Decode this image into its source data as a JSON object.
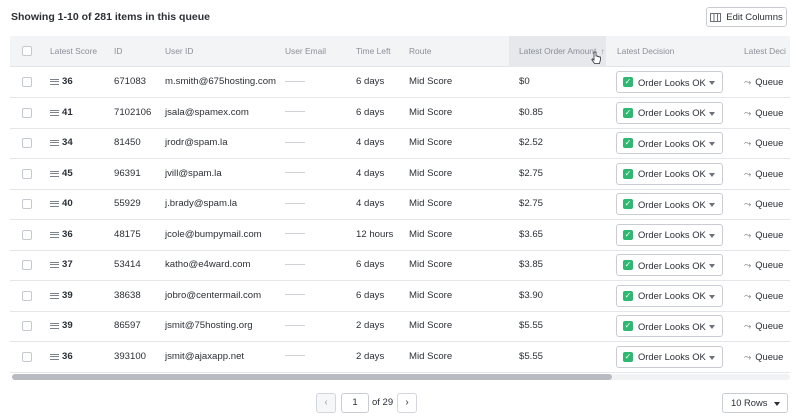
{
  "header": {
    "summary": "Showing 1-10 of 281 items in this queue",
    "edit_columns_label": "Edit Columns"
  },
  "columns": {
    "score": "Latest Score",
    "id": "ID",
    "user_id": "User ID",
    "user_email": "User Email",
    "time_left": "Time Left",
    "route": "Route",
    "amount": "Latest Order Amount",
    "decision": "Latest Decision",
    "decision2": "Latest Deci"
  },
  "sort": {
    "column": "Latest Order Amount",
    "direction": "ascending"
  },
  "rows": [
    {
      "score": "36",
      "id": "671083",
      "user_id": "m.smith@675hosting.com",
      "time_left": "6 days",
      "route": "Mid Score",
      "amount": "$0",
      "decision": "Order Looks OK",
      "queue": "Queue"
    },
    {
      "score": "41",
      "id": "7102106",
      "user_id": "jsala@spamex.com",
      "time_left": "6 days",
      "route": "Mid Score",
      "amount": "$0.85",
      "decision": "Order Looks OK",
      "queue": "Queue"
    },
    {
      "score": "34",
      "id": "81450",
      "user_id": "jrodr@spam.la",
      "time_left": "4 days",
      "route": "Mid Score",
      "amount": "$2.52",
      "decision": "Order Looks OK",
      "queue": "Queue"
    },
    {
      "score": "45",
      "id": "96391",
      "user_id": "jvill@spam.la",
      "time_left": "4 days",
      "route": "Mid Score",
      "amount": "$2.75",
      "decision": "Order Looks OK",
      "queue": "Queue"
    },
    {
      "score": "40",
      "id": "55929",
      "user_id": "j.brady@spam.la",
      "time_left": "4 days",
      "route": "Mid Score",
      "amount": "$2.75",
      "decision": "Order Looks OK",
      "queue": "Queue"
    },
    {
      "score": "36",
      "id": "48175",
      "user_id": "jcole@bumpymail.com",
      "time_left": "12 hours",
      "route": "Mid Score",
      "amount": "$3.65",
      "decision": "Order Looks OK",
      "queue": "Queue"
    },
    {
      "score": "37",
      "id": "53414",
      "user_id": "katho@e4ward.com",
      "time_left": "6 days",
      "route": "Mid Score",
      "amount": "$3.85",
      "decision": "Order Looks OK",
      "queue": "Queue"
    },
    {
      "score": "39",
      "id": "38638",
      "user_id": "jobro@centermail.com",
      "time_left": "6 days",
      "route": "Mid Score",
      "amount": "$3.90",
      "decision": "Order Looks OK",
      "queue": "Queue"
    },
    {
      "score": "39",
      "id": "86597",
      "user_id": "jsmit@75hosting.org",
      "time_left": "2 days",
      "route": "Mid Score",
      "amount": "$5.55",
      "decision": "Order Looks OK",
      "queue": "Queue"
    },
    {
      "score": "36",
      "id": "393100",
      "user_id": "jsmit@ajaxapp.net",
      "time_left": "2 days",
      "route": "Mid Score",
      "amount": "$5.55",
      "decision": "Order Looks OK",
      "queue": "Queue"
    }
  ],
  "pagination": {
    "prev": "‹",
    "next": "›",
    "current_page": "1",
    "of_label": "of 29",
    "rows_per_page": "10 Rows"
  },
  "colors": {
    "accent_green": "#2eb872",
    "header_bg": "#f3f4f6"
  },
  "icons": {
    "edit_columns": "columns-icon",
    "decision_check": "check-icon",
    "queue": "route-icon",
    "score": "score-bars-icon"
  }
}
